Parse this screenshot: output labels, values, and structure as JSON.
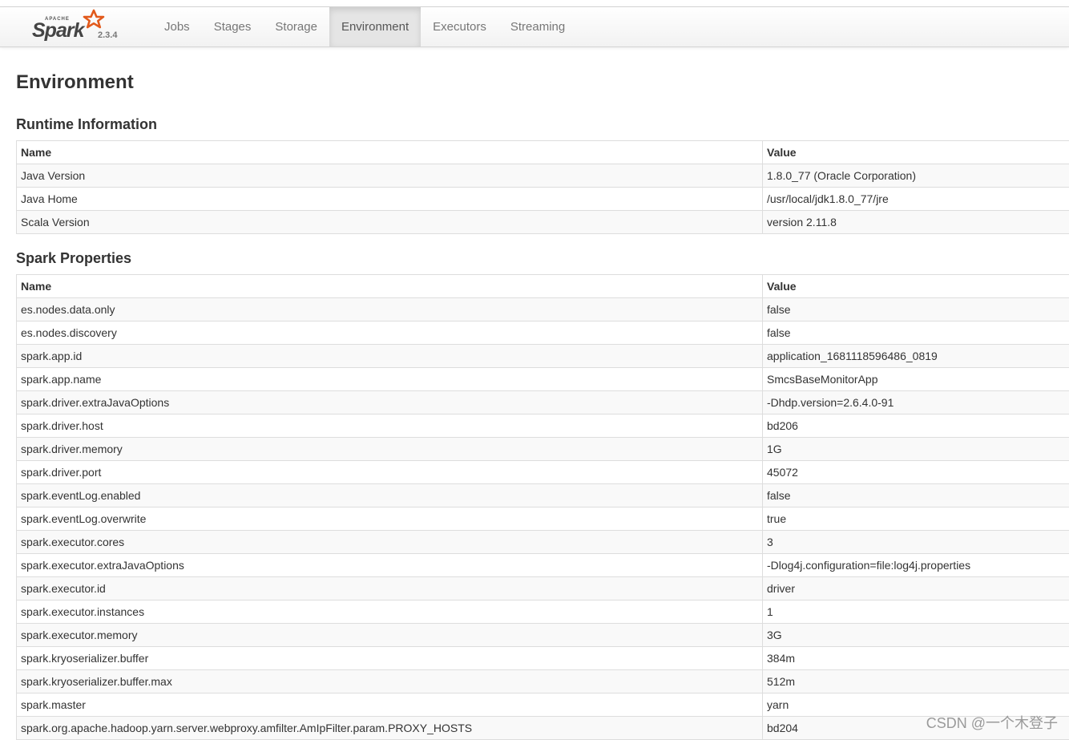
{
  "brand": {
    "apache_label": "APACHE",
    "name": "Spark",
    "version": "2.3.4",
    "logo_icon": "spark-star-icon",
    "accent_color": "#e25a1c"
  },
  "nav": {
    "items": [
      {
        "label": "Jobs"
      },
      {
        "label": "Stages"
      },
      {
        "label": "Storage"
      },
      {
        "label": "Environment",
        "active": true
      },
      {
        "label": "Executors"
      },
      {
        "label": "Streaming"
      }
    ]
  },
  "page": {
    "title": "Environment"
  },
  "runtime": {
    "title": "Runtime Information",
    "headers": [
      "Name",
      "Value"
    ],
    "rows": [
      [
        "Java Version",
        "1.8.0_77 (Oracle Corporation)"
      ],
      [
        "Java Home",
        "/usr/local/jdk1.8.0_77/jre"
      ],
      [
        "Scala Version",
        "version 2.11.8"
      ]
    ]
  },
  "spark_props": {
    "title": "Spark Properties",
    "headers": [
      "Name",
      "Value"
    ],
    "rows": [
      [
        "es.nodes.data.only",
        "false"
      ],
      [
        "es.nodes.discovery",
        "false"
      ],
      [
        "spark.app.id",
        "application_1681118596486_0819"
      ],
      [
        "spark.app.name",
        "SmcsBaseMonitorApp"
      ],
      [
        "spark.driver.extraJavaOptions",
        "-Dhdp.version=2.6.4.0-91"
      ],
      [
        "spark.driver.host",
        "bd206"
      ],
      [
        "spark.driver.memory",
        "1G"
      ],
      [
        "spark.driver.port",
        "45072"
      ],
      [
        "spark.eventLog.enabled",
        "false"
      ],
      [
        "spark.eventLog.overwrite",
        "true"
      ],
      [
        "spark.executor.cores",
        "3"
      ],
      [
        "spark.executor.extraJavaOptions",
        "-Dlog4j.configuration=file:log4j.properties"
      ],
      [
        "spark.executor.id",
        "driver"
      ],
      [
        "spark.executor.instances",
        "1"
      ],
      [
        "spark.executor.memory",
        "3G"
      ],
      [
        "spark.kryoserializer.buffer",
        "384m"
      ],
      [
        "spark.kryoserializer.buffer.max",
        "512m"
      ],
      [
        "spark.master",
        "yarn"
      ],
      [
        "spark.org.apache.hadoop.yarn.server.webproxy.amfilter.AmIpFilter.param.PROXY_HOSTS",
        "bd204"
      ]
    ]
  },
  "watermark": "CSDN @一个木登子"
}
